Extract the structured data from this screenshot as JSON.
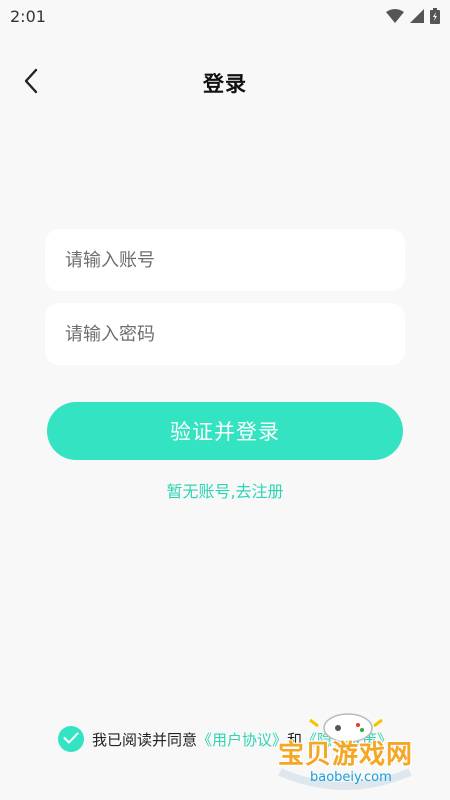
{
  "status_bar": {
    "time": "2:01"
  },
  "nav": {
    "title": "登录"
  },
  "form": {
    "account_placeholder": "请输入账号",
    "password_placeholder": "请输入密码",
    "submit_label": "验证并登录",
    "register_link": "暂无账号,去注册"
  },
  "agreement": {
    "checked": true,
    "prefix": "我已阅读并同意",
    "user_agreement": "《用户协议》",
    "and": "和",
    "privacy_policy": "《隐私政策》"
  },
  "watermark": {
    "text": "宝贝游戏网",
    "url": "baobeiy.com"
  },
  "colors": {
    "accent": "#34e3c1",
    "link": "#2fd4b3",
    "background": "#f8f8f8"
  },
  "icons": [
    "wifi-icon",
    "signal-icon",
    "battery-icon",
    "back-arrow-icon",
    "checkmark-icon"
  ]
}
